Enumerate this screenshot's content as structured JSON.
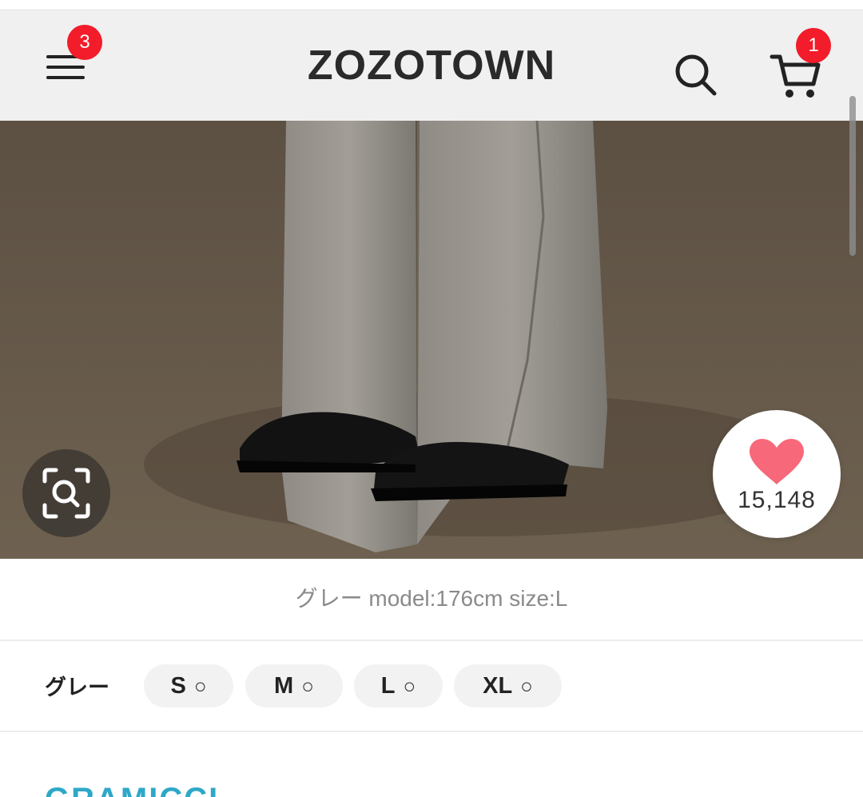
{
  "header": {
    "logo": "ZOZOTOWN",
    "menu_badge": "3",
    "cart_badge": "1",
    "icons": [
      "menu-icon",
      "search-icon",
      "cart-icon"
    ]
  },
  "hero": {
    "image": "grey wide-leg pants with black boots on concrete floor",
    "favorite_count": "15,148",
    "icons": [
      "zoom-scan-icon",
      "heart-icon"
    ]
  },
  "caption": "グレー model:176cm size:L",
  "sizes": {
    "color_label": "グレー",
    "options": [
      {
        "size": "S",
        "stock": "○"
      },
      {
        "size": "M",
        "stock": "○"
      },
      {
        "size": "L",
        "stock": "○"
      },
      {
        "size": "XL",
        "stock": "○"
      }
    ]
  },
  "brand_peek": "GRAMICCI",
  "colors": {
    "badge": "#f21c2a",
    "heart": "#f7687a",
    "header_bg": "#f0f0f0",
    "brand": "#2fa8c8"
  }
}
